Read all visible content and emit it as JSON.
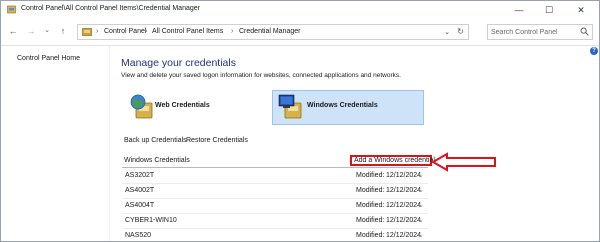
{
  "window": {
    "title": "Control Panel\\All Control Panel Items\\Credential Manager",
    "minimize_glyph": "—",
    "maximize_glyph": "☐",
    "close_glyph": "✕"
  },
  "nav": {
    "back_glyph": "←",
    "forward_glyph": "→",
    "recent_glyph": "⌄",
    "up_glyph": "↑"
  },
  "breadcrumb": {
    "items": [
      "Control Panel",
      "All Control Panel Items",
      "Credential Manager"
    ],
    "separator": "›",
    "dropdown_glyph": "⌄",
    "refresh_glyph": "↻"
  },
  "search": {
    "placeholder": "Search Control Panel",
    "icon": "search-icon"
  },
  "left_pane": {
    "home_link": "Control Panel Home"
  },
  "main": {
    "title": "Manage your credentials",
    "description": "View and delete your saved logon information for websites, connected applications and networks.",
    "tiles": [
      {
        "label": "Web Credentials",
        "icon": "web-credentials-icon",
        "selected": false
      },
      {
        "label": "Windows Credentials",
        "icon": "windows-credentials-icon",
        "selected": true
      }
    ],
    "backup_link": "Back up Credentials",
    "restore_link": "Restore Credentials",
    "section_title": "Windows Credentials",
    "add_link": "Add a Windows credential",
    "rows": [
      {
        "name": "AS3202T",
        "modified_label": "Modified:",
        "modified_date": "12/12/2024",
        "chevron": "⌄"
      },
      {
        "name": "AS4002T",
        "modified_label": "Modified:",
        "modified_date": "12/12/2024",
        "chevron": "⌄"
      },
      {
        "name": "AS4004T",
        "modified_label": "Modified:",
        "modified_date": "12/12/2024",
        "chevron": "⌄"
      },
      {
        "name": "CYBER1-WIN10",
        "modified_label": "Modified:",
        "modified_date": "12/12/2024",
        "chevron": "⌄"
      },
      {
        "name": "NAS520",
        "modified_label": "Modified:",
        "modified_date": "12/12/2024",
        "chevron": "⌄"
      }
    ]
  },
  "help_glyph": "?",
  "colors": {
    "title_blue": "#1e3287",
    "selected_tile": "#cfe3f8",
    "highlight_red": "#d9141b"
  }
}
